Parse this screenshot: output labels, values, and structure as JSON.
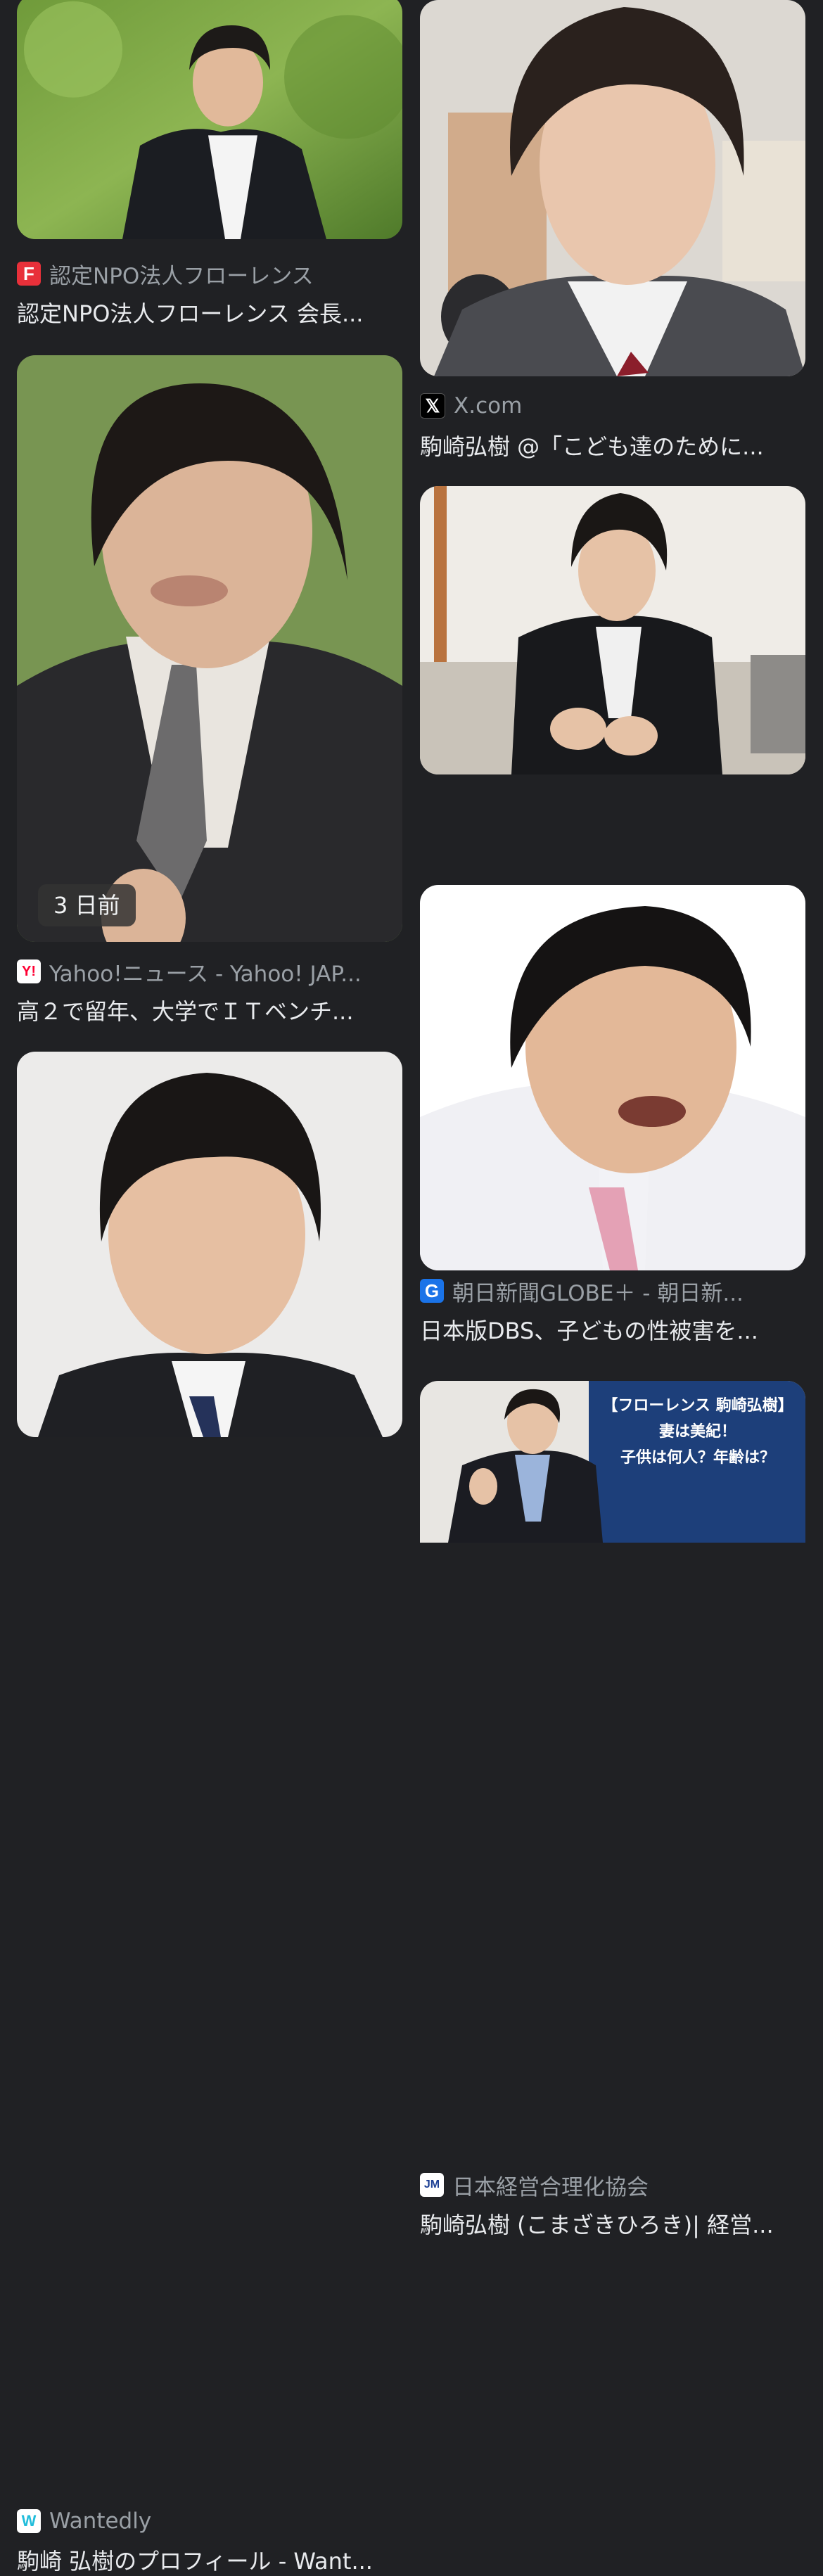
{
  "results": [
    {
      "source": "認定NPO法人フローレンス",
      "title": "認定NPO法人フローレンス 会長...",
      "favicon": "florence-f-icon",
      "favicon_color": "#e8303a"
    },
    {
      "source": "X.com",
      "title": "駒崎弘樹 @「こども達のために...",
      "favicon": "x-logo-icon",
      "favicon_color": "#000000"
    },
    {
      "source": "朝日新聞GLOBE＋ - 朝日新...",
      "title": "日本版DBS、子どもの性被害を...",
      "favicon": "globe-g-icon",
      "favicon_color": "#1a73e8"
    },
    {
      "source": "Yahoo!ニュース - Yahoo! JAP...",
      "title": "高２で留年、大学でＩＴベンチ...",
      "badge": "3 日前",
      "favicon": "yahoo-y-icon",
      "favicon_color": "#ff0033"
    },
    {
      "source": "日本経営合理化協会",
      "title": "駒崎弘樹 (こまざきひろき)| 経営...",
      "favicon": "jmca-icon",
      "favicon_color": "#1c3f94"
    },
    {
      "source": "Wantedly",
      "title": "駒崎 弘樹のプロフィール - Want...",
      "favicon": "wantedly-w-icon",
      "favicon_color": "#21bddb"
    },
    {
      "source": "",
      "title": "",
      "image_text": [
        "【フローレンス 駒崎弘樹】",
        "妻は美紀！",
        "子供は何人？年齢は？"
      ]
    }
  ]
}
